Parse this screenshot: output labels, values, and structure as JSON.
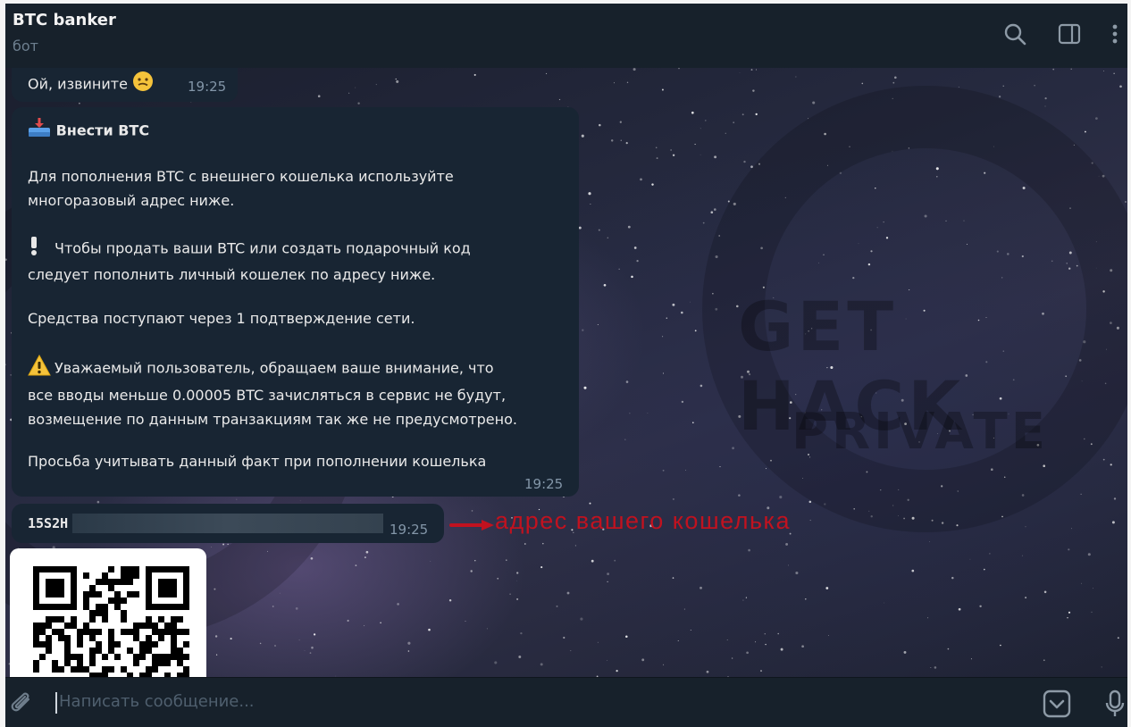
{
  "header": {
    "title": "BTC banker",
    "subtitle": "бот",
    "icons": [
      "search-icon",
      "sidebar-toggle-icon",
      "more-vertical-icon"
    ]
  },
  "messages": [
    {
      "text": "Ой, извините",
      "emoji": "confused-face-emoji",
      "time": "19:25"
    },
    {
      "title": "Внести BTC",
      "title_icon": "inbox-tray-emoji",
      "lines": [
        "Для пополнения BTC с внешнего кошелька используйте",
        "многоразовый адрес ниже."
      ],
      "notice_lines": [
        "Чтобы продать ваши BTC или создать подарочный код",
        "следует пополнить личный кошелек по адресу ниже."
      ],
      "notice_icon": "exclamation-emoji",
      "confirm_text": "Средства поступают через 1 подтверждение сети.",
      "warning_lines": [
        "Уважаемый пользователь, обращаем ваше внимание, что",
        "все вводы меньше 0.00005 BTC зачисляться в сервис не будут,",
        "возмещение по данным транзакциям так же не предусмотрено."
      ],
      "warning_icon": "warning-emoji",
      "footer_text": "Просьба учитывать данный факт при пополнении кошелька",
      "time": "19:25"
    },
    {
      "address_prefix": "15S2H",
      "time": "19:25"
    }
  ],
  "annotation": {
    "text": "адрес вашего кошелька",
    "color": "#c1121f"
  },
  "watermark": {
    "line1": "GET HACK",
    "line2": "PRIVATE"
  },
  "composer": {
    "placeholder": "Написать сообщение...",
    "icons": [
      "attach-icon",
      "bot-commands-icon",
      "microphone-icon"
    ]
  },
  "colors": {
    "bubble": "#182533",
    "header": "#17212b",
    "time": "#8396a8"
  }
}
